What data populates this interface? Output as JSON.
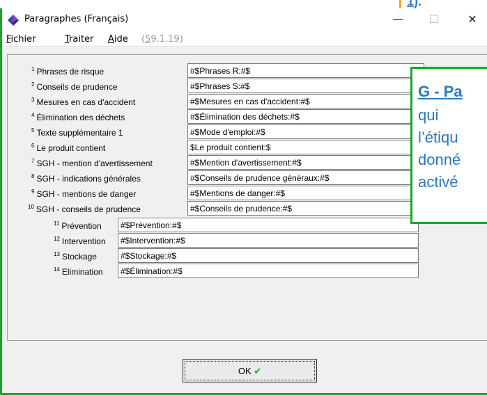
{
  "background_callout": {
    "text": "1",
    "suffix": ")."
  },
  "window": {
    "title": "Paragraphes (Français)",
    "controls": {
      "minimize": "—",
      "maximize": "☐",
      "close": "✕"
    }
  },
  "menu": {
    "fichier": {
      "ul": "F",
      "rest": "ichier"
    },
    "traiter": {
      "ul": "T",
      "rest": "raiter"
    },
    "aide": {
      "ul": "A",
      "rest": "ide"
    },
    "version": {
      "pre": "(",
      "ul": "5",
      "rest": "9.1.19)"
    }
  },
  "rows": [
    {
      "num": "1",
      "label": "Phrases de risque",
      "value": "#$Phrases R:#$"
    },
    {
      "num": "2",
      "label": "Conseils de prudence",
      "value": "#$Phrases S:#$"
    },
    {
      "num": "3",
      "label": "Mesures en cas d'accident",
      "value": "#$Mesures en cas d'accident:#$"
    },
    {
      "num": "4",
      "label": "Élimination des déchets",
      "value": "#$Élimination des déchets:#$"
    },
    {
      "num": "5",
      "label": "Texte supplémentaire 1",
      "value": "#$Mode d'emploi:#$"
    },
    {
      "num": "6",
      "label": "Le produit contient",
      "value": "$Le produit contient:$"
    },
    {
      "num": "7",
      "label": "SGH - mention d'avertissement",
      "value": "#$Mention d'avertissement:#$"
    },
    {
      "num": "8",
      "label": "SGH - indications générales",
      "value": "#$Conseils de prudence généraux:#$"
    },
    {
      "num": "9",
      "label": "SGH - mentions de danger",
      "value": "#$Mentions de danger:#$"
    },
    {
      "num": "10",
      "label": "SGH - conseils de prudence",
      "value": "#$Conseils de prudence:#$"
    },
    {
      "num": "11",
      "label": "Prévention",
      "value": "#$Prévention:#$"
    },
    {
      "num": "12",
      "label": "Intervention",
      "value": "#$Intervention:#$"
    },
    {
      "num": "13",
      "label": "Stockage",
      "value": "#$Stockage:#$"
    },
    {
      "num": "14",
      "label": "Elimination",
      "value": "#$Élimination:#$"
    }
  ],
  "ok_button": {
    "label": "OK",
    "check": "✔"
  },
  "callout_g": {
    "title": "G - Pa",
    "line1": "qui",
    "line2": "l’étiqu",
    "line3": "donné",
    "line4": "activé"
  },
  "colors": {
    "accent_green": "#1aa52a",
    "accent_orange": "#f5a623",
    "callout_blue": "#2b78c2"
  }
}
